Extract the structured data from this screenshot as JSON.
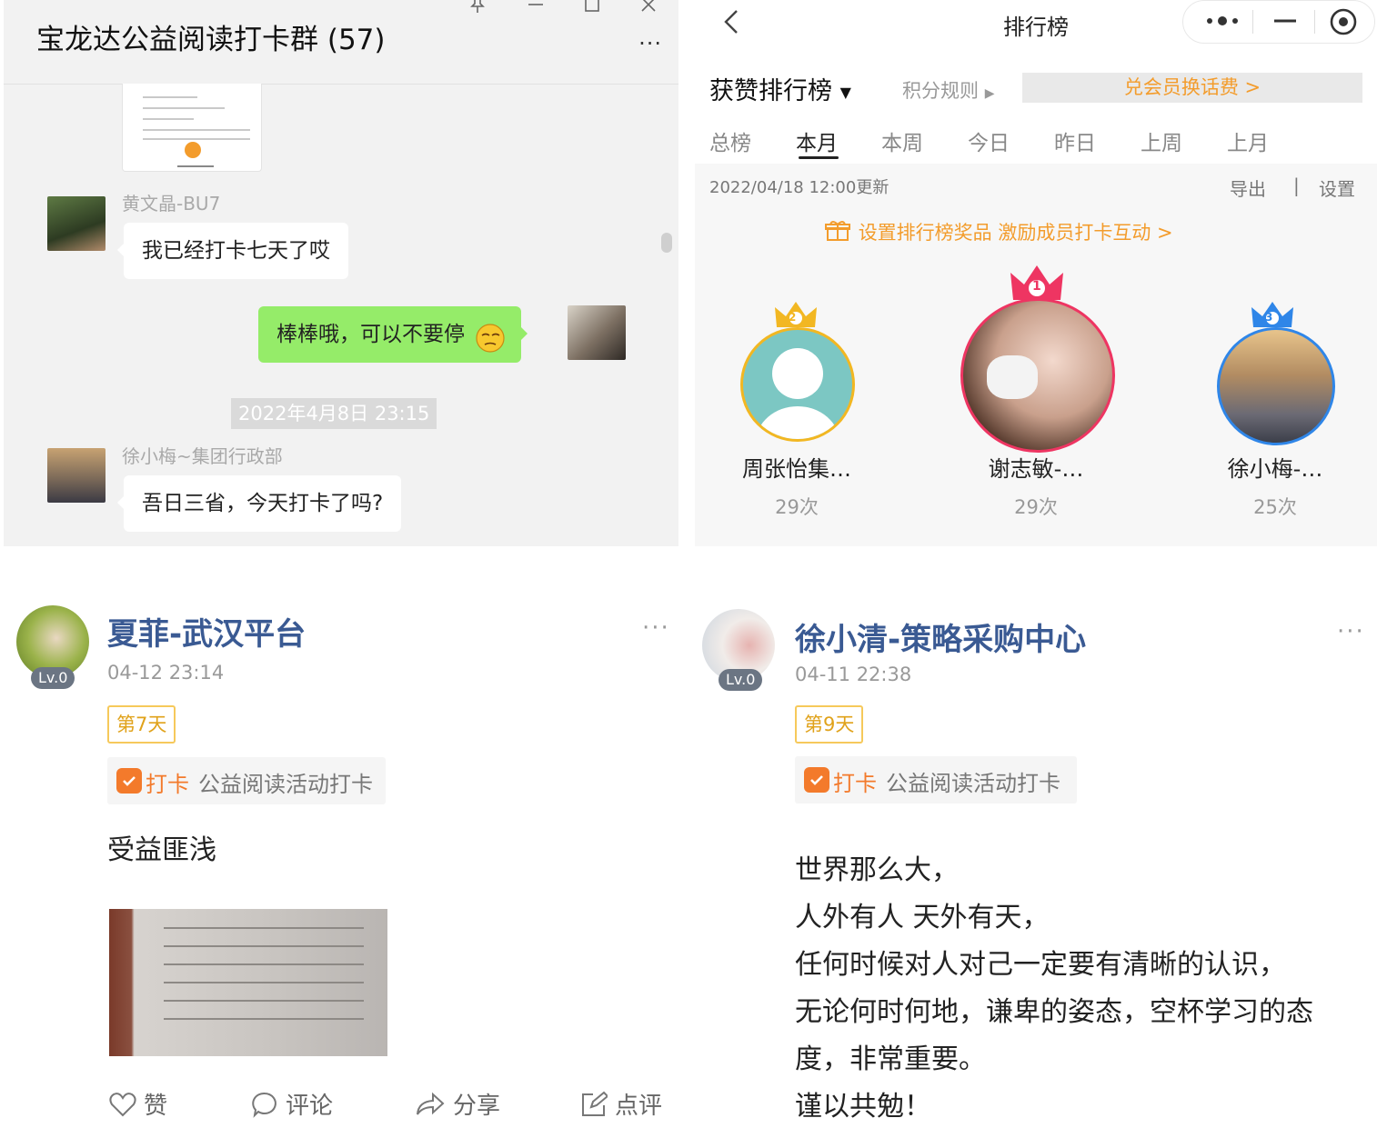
{
  "chat": {
    "title": "宝龙达公益阅读打卡群 (57)",
    "window_controls": [
      "pin-icon",
      "minimize-icon",
      "maximize-icon",
      "close-icon"
    ],
    "more_label": "···",
    "messages": [
      {
        "sender": "黄文晶-BU7",
        "text": "我已经打卡七天了哎"
      },
      {
        "sender": "",
        "text": "棒棒哦，可以不要停"
      },
      {
        "sender": "徐小梅~集团行政部",
        "text": "吾日三省，今天打卡了吗?"
      }
    ],
    "timestamp": "2022年4月8日 23:15"
  },
  "ranking": {
    "title": "排行榜",
    "back_icon": "chevron-left-icon",
    "board_select": "获赞排行榜",
    "rules_link": "积分规则",
    "redeem_link": "兑会员换话费 >",
    "tabs": [
      "总榜",
      "本月",
      "本周",
      "今日",
      "昨日",
      "上周",
      "上月"
    ],
    "active_tab": "本月",
    "updated": "2022/04/18 12:00更新",
    "export_label": "导出",
    "separator": "|",
    "settings_label": "设置",
    "prize_banner": "设置排行榜奖品 激励成员打卡互动 >",
    "podium": [
      {
        "rank": "2",
        "name": "周张怡集…",
        "count": "29次",
        "color": "#f2b722"
      },
      {
        "rank": "1",
        "name": "谢志敏-…",
        "count": "29次",
        "color": "#ee3562"
      },
      {
        "rank": "3",
        "name": "徐小梅-…",
        "count": "25次",
        "color": "#2f86e8"
      }
    ]
  },
  "posts": [
    {
      "name": "夏菲-武汉平台",
      "level": "Lv.0",
      "time": "04-12 23:14",
      "day_tag": "第7天",
      "checkin_label": "打卡",
      "checkin_activity": "公益阅读活动打卡",
      "lines": [
        "受益匪浅"
      ],
      "actions": {
        "like": "赞",
        "comment": "评论",
        "share": "分享",
        "review": "点评"
      }
    },
    {
      "name": "徐小清-策略采购中心",
      "level": "Lv.0",
      "time": "04-11 22:38",
      "day_tag": "第9天",
      "checkin_label": "打卡",
      "checkin_activity": "公益阅读活动打卡",
      "lines": [
        "世界那么大，",
        "人外有人 天外有天，",
        "任何时候对人对己一定要有清晰的认识，",
        "无论何时何地，谦卑的姿态，空杯学习的态",
        "度，非常重要。",
        "谨以共勉！"
      ]
    }
  ],
  "colors": {
    "chat_green": "#95ec69",
    "link_orange": "#f39c2c",
    "name_blue": "#3a5a93"
  }
}
